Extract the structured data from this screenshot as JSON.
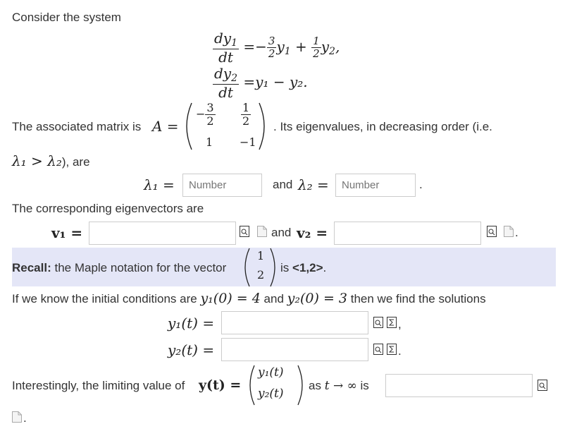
{
  "intro": "Consider the system",
  "system": {
    "eq1_lhs_num": "dy",
    "eq1_lhs_sub": "1",
    "eq1_lhs_den": "dt",
    "eq1_c1_num": "3",
    "eq1_c1_den": "2",
    "eq1_c2_num": "1",
    "eq1_c2_den": "2",
    "eq2_lhs_num": "dy",
    "eq2_lhs_sub": "2",
    "eq2_lhs_den": "dt",
    "eq2_rhs": "=y₁ − y₂."
  },
  "matrix": {
    "prefix": "The associated matrix is",
    "symbol": "A =",
    "a11_num": "3",
    "a11_den": "2",
    "a12_num": "1",
    "a12_den": "2",
    "a21": "1",
    "a22": "−1",
    "suffix": ". Its eigenvalues, in decreasing order (i.e."
  },
  "order_line": {
    "math": "λ₁ > λ₂",
    "text": "), are"
  },
  "eigen": {
    "lambda1_label": "λ₁ =",
    "lambda1_placeholder": "Number",
    "and_text": "and",
    "lambda2_label": "λ₂ =",
    "lambda2_placeholder": "Number",
    "period": "."
  },
  "eigvec_intro": "The corresponding eigenvectors are",
  "vectors": {
    "v1_label": "v₁ =",
    "and_text": "and",
    "v2_label": "v₂ ="
  },
  "recall": {
    "bold": "Recall:",
    "text": "the Maple notation for the vector",
    "vec_top": "1",
    "vec_bottom": "2",
    "is_text": "is",
    "code": "<1,2>",
    "period": "."
  },
  "initial": {
    "text1": "If we know the initial conditions are",
    "cond1": "y₁(0) = 4",
    "and_text": "and",
    "cond2": "y₂(0) = 3",
    "text2": "then we find the solutions"
  },
  "solutions": {
    "y1_label": "y₁(t) =",
    "y2_label": "y₂(t) =",
    "comma": ",",
    "period": "."
  },
  "limit": {
    "text": "Interestingly, the limiting value of",
    "ylabel": "y(t) =",
    "vec_top": "y₁(t)",
    "vec_bottom": "y₂(t)",
    "as_text": "as",
    "arrow": "t → ∞",
    "is_text": "is",
    "period": "."
  }
}
